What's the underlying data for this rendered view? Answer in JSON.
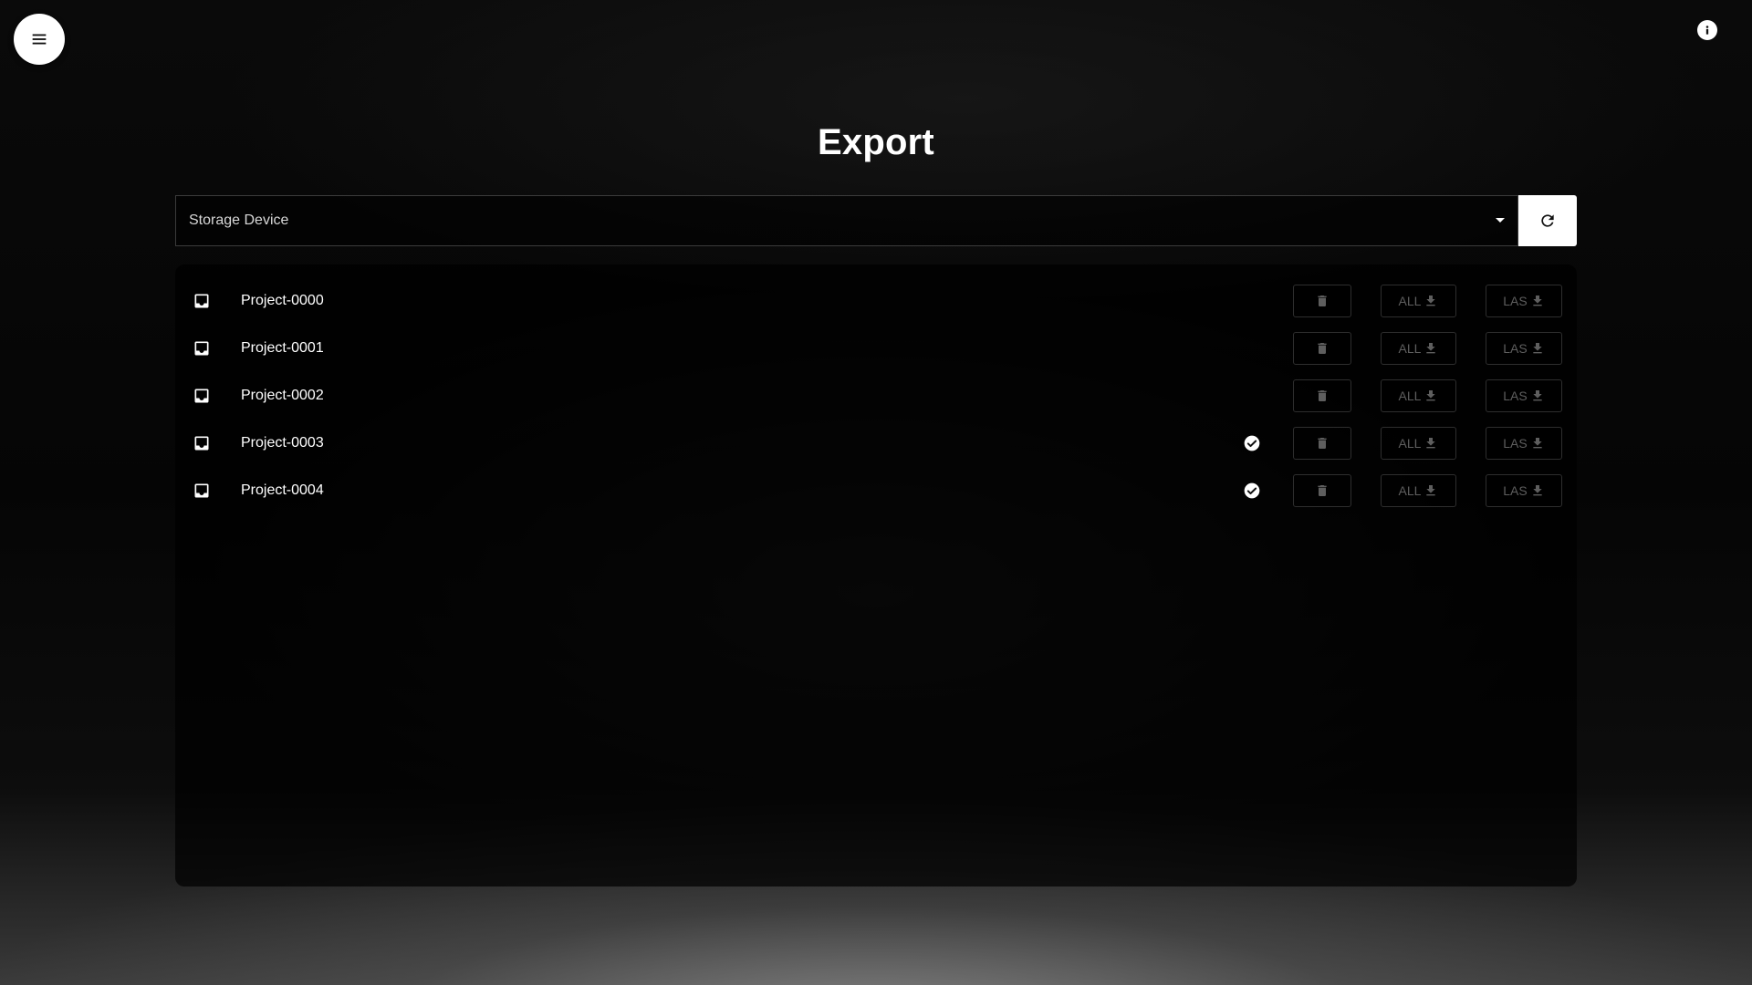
{
  "header": {
    "menu_icon": "hamburger-menu-icon",
    "info_icon": "info-icon",
    "title": "Export"
  },
  "storage": {
    "placeholder": "Storage Device",
    "refresh_icon": "refresh-icon"
  },
  "projects": [
    {
      "name": "Project-0000",
      "exported": false
    },
    {
      "name": "Project-0001",
      "exported": false
    },
    {
      "name": "Project-0002",
      "exported": false
    },
    {
      "name": "Project-0003",
      "exported": true
    },
    {
      "name": "Project-0004",
      "exported": true
    }
  ],
  "actions": {
    "all_label": "ALL",
    "las_label": "LAS",
    "delete_icon": "trash-icon",
    "download_icon": "download-icon"
  },
  "colors": {
    "background": "#050505",
    "accent": "#ffffff",
    "disabled_text": "#5e5e5e"
  }
}
